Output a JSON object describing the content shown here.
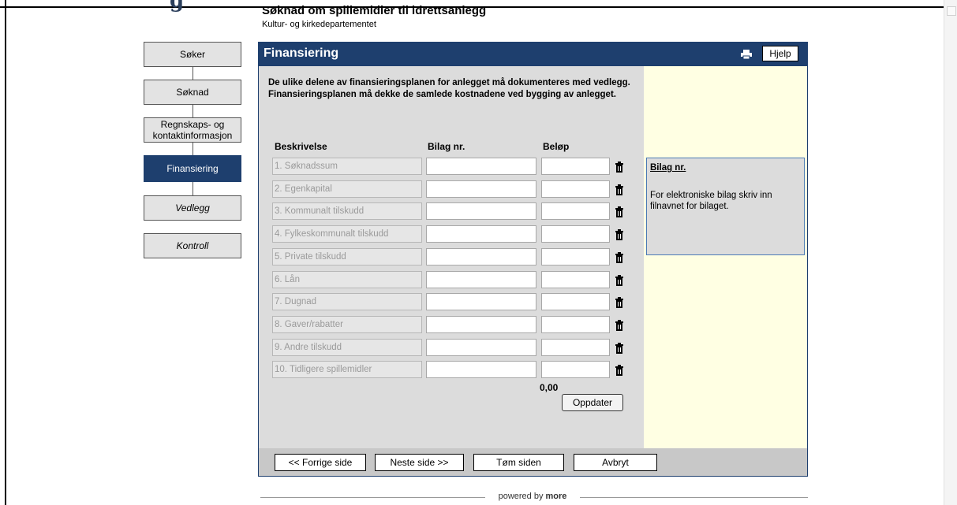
{
  "header": {
    "logo_fragment": "g",
    "title": "Søknad om spillemidler til idrettsanlegg",
    "subtitle": "Kultur- og kirkedepartementet"
  },
  "nav": {
    "items": [
      {
        "label": "Søker"
      },
      {
        "label": "Søknad"
      },
      {
        "label": "Regnskaps- og kontaktinformasjon"
      },
      {
        "label": "Finansiering"
      },
      {
        "label": "Vedlegg"
      },
      {
        "label": "Kontroll"
      }
    ]
  },
  "panel": {
    "title": "Finansiering",
    "help_label": "Hjelp",
    "print_icon": "printer-icon",
    "intro": "De ulike delene av finansieringsplanen for anlegget må dokumenteres med vedlegg. Finansieringsplanen må dekke de samlede kostnadene ved bygging av anlegget."
  },
  "table": {
    "headers": {
      "description": "Beskrivelse",
      "attachment": "Bilag nr.",
      "amount": "Beløp"
    },
    "rows": [
      {
        "description": "1. Søknadssum",
        "attachment": "",
        "amount": ""
      },
      {
        "description": "2. Egenkapital",
        "attachment": "",
        "amount": ""
      },
      {
        "description": "3. Kommunalt tilskudd",
        "attachment": "",
        "amount": ""
      },
      {
        "description": "4. Fylkeskommunalt tilskudd",
        "attachment": "",
        "amount": ""
      },
      {
        "description": "5. Private tilskudd",
        "attachment": "",
        "amount": ""
      },
      {
        "description": "6. Lån",
        "attachment": "",
        "amount": ""
      },
      {
        "description": "7. Dugnad",
        "attachment": "",
        "amount": ""
      },
      {
        "description": "8. Gaver/rabatter",
        "attachment": "",
        "amount": ""
      },
      {
        "description": "9. Andre tilskudd",
        "attachment": "",
        "amount": ""
      },
      {
        "description": "10. Tidligere spillemidler",
        "attachment": "",
        "amount": ""
      }
    ],
    "total": "0,00",
    "update_label": "Oppdater"
  },
  "info": {
    "title": "Bilag nr.",
    "text": "For elektroniske bilag skriv inn filnavnet for bilaget."
  },
  "footer_buttons": {
    "previous": "<< Forrige side",
    "next": "Neste side >>",
    "clear": "Tøm siden",
    "cancel": "Avbryt"
  },
  "powered": {
    "prefix": "powered by",
    "brand": "more"
  },
  "colors": {
    "accent": "#1e3f6e",
    "panel_bg": "#dcdcdc",
    "help_bg": "#ffffe3",
    "info_border": "#4a7ab5"
  }
}
